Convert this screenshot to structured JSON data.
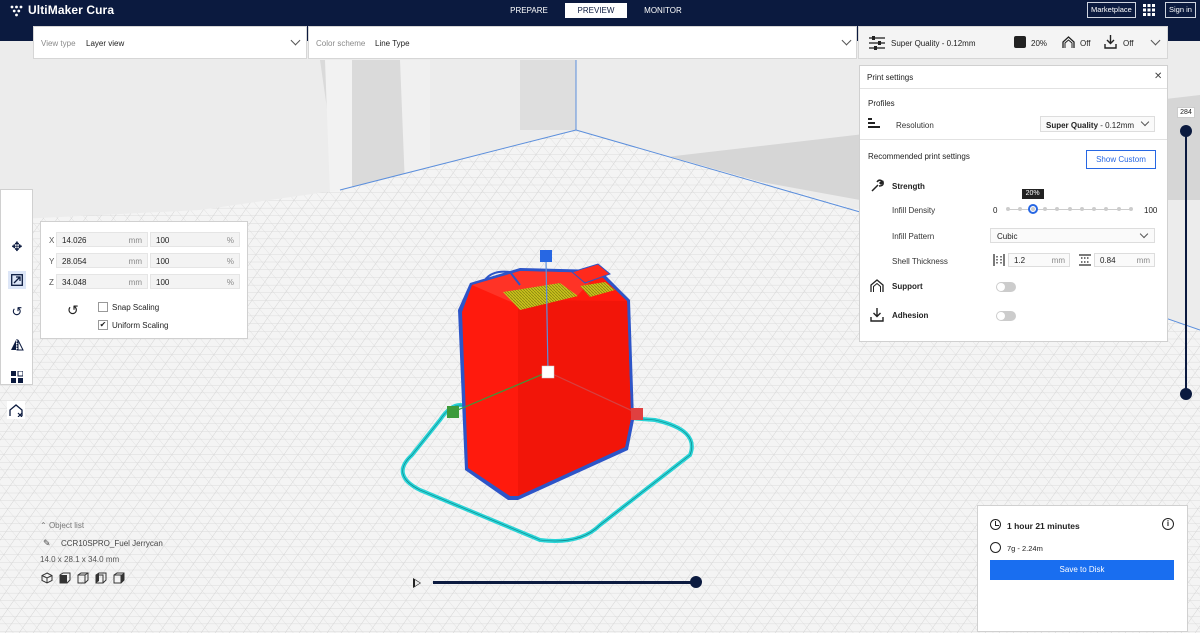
{
  "app": {
    "title": "UltiMaker Cura"
  },
  "nav": {
    "tabs": [
      {
        "label": "PREPARE"
      },
      {
        "label": "PREVIEW"
      },
      {
        "label": "MONITOR"
      }
    ],
    "active_tab": "PREVIEW"
  },
  "topbar": {
    "marketplace": "Marketplace",
    "signin": "Sign in"
  },
  "view_type": {
    "label": "View type",
    "value": "Layer view"
  },
  "color_scheme": {
    "label": "Color scheme",
    "value": "Line Type"
  },
  "print_summary": {
    "profile": "Super Quality - 0.12mm",
    "infill": "20%",
    "support": "Off",
    "adhesion": "Off"
  },
  "print_settings": {
    "title": "Print settings",
    "profiles_label": "Profiles",
    "resolution_label": "Resolution",
    "resolution_value_bold": "Super Quality",
    "resolution_value_rest": " - 0.12mm",
    "recommended_label": "Recommended print settings",
    "show_custom": "Show Custom",
    "strength_label": "Strength",
    "infill_density_label": "Infill Density",
    "infill_min": "0",
    "infill_max": "100",
    "infill_value": "20%",
    "infill_fraction": 0.2,
    "infill_pattern_label": "Infill Pattern",
    "infill_pattern_value": "Cubic",
    "shell_thickness_label": "Shell Thickness",
    "wall_value": "1.2",
    "top_bottom_value": "0.84",
    "unit_mm": "mm",
    "support_label": "Support",
    "adhesion_label": "Adhesion"
  },
  "layer_slider": {
    "current_layer": "284"
  },
  "scale_tool": {
    "rows": [
      {
        "axis": "X",
        "mm": "14.026",
        "pct": "100"
      },
      {
        "axis": "Y",
        "mm": "28.054",
        "pct": "100"
      },
      {
        "axis": "Z",
        "mm": "34.048",
        "pct": "100"
      }
    ],
    "unit_mm": "mm",
    "unit_pct": "%",
    "snap_scaling": "Snap Scaling",
    "uniform_scaling": "Uniform Scaling",
    "snap_checked": false,
    "uniform_checked": true
  },
  "object_list": {
    "header": "Object list",
    "object_name": "CCR10SPRO_Fuel Jerrycan",
    "dimensions": "14.0 x 28.1 x 34.0 mm"
  },
  "job": {
    "time": "1 hour 21 minutes",
    "material": "7g - 2.24m",
    "save_label": "Save to Disk"
  },
  "colors": {
    "nav_bg": "#0b1a3f",
    "accent": "#196ef0",
    "model_red": "#ff1a0d",
    "outline_cyan": "#29d3d6"
  }
}
